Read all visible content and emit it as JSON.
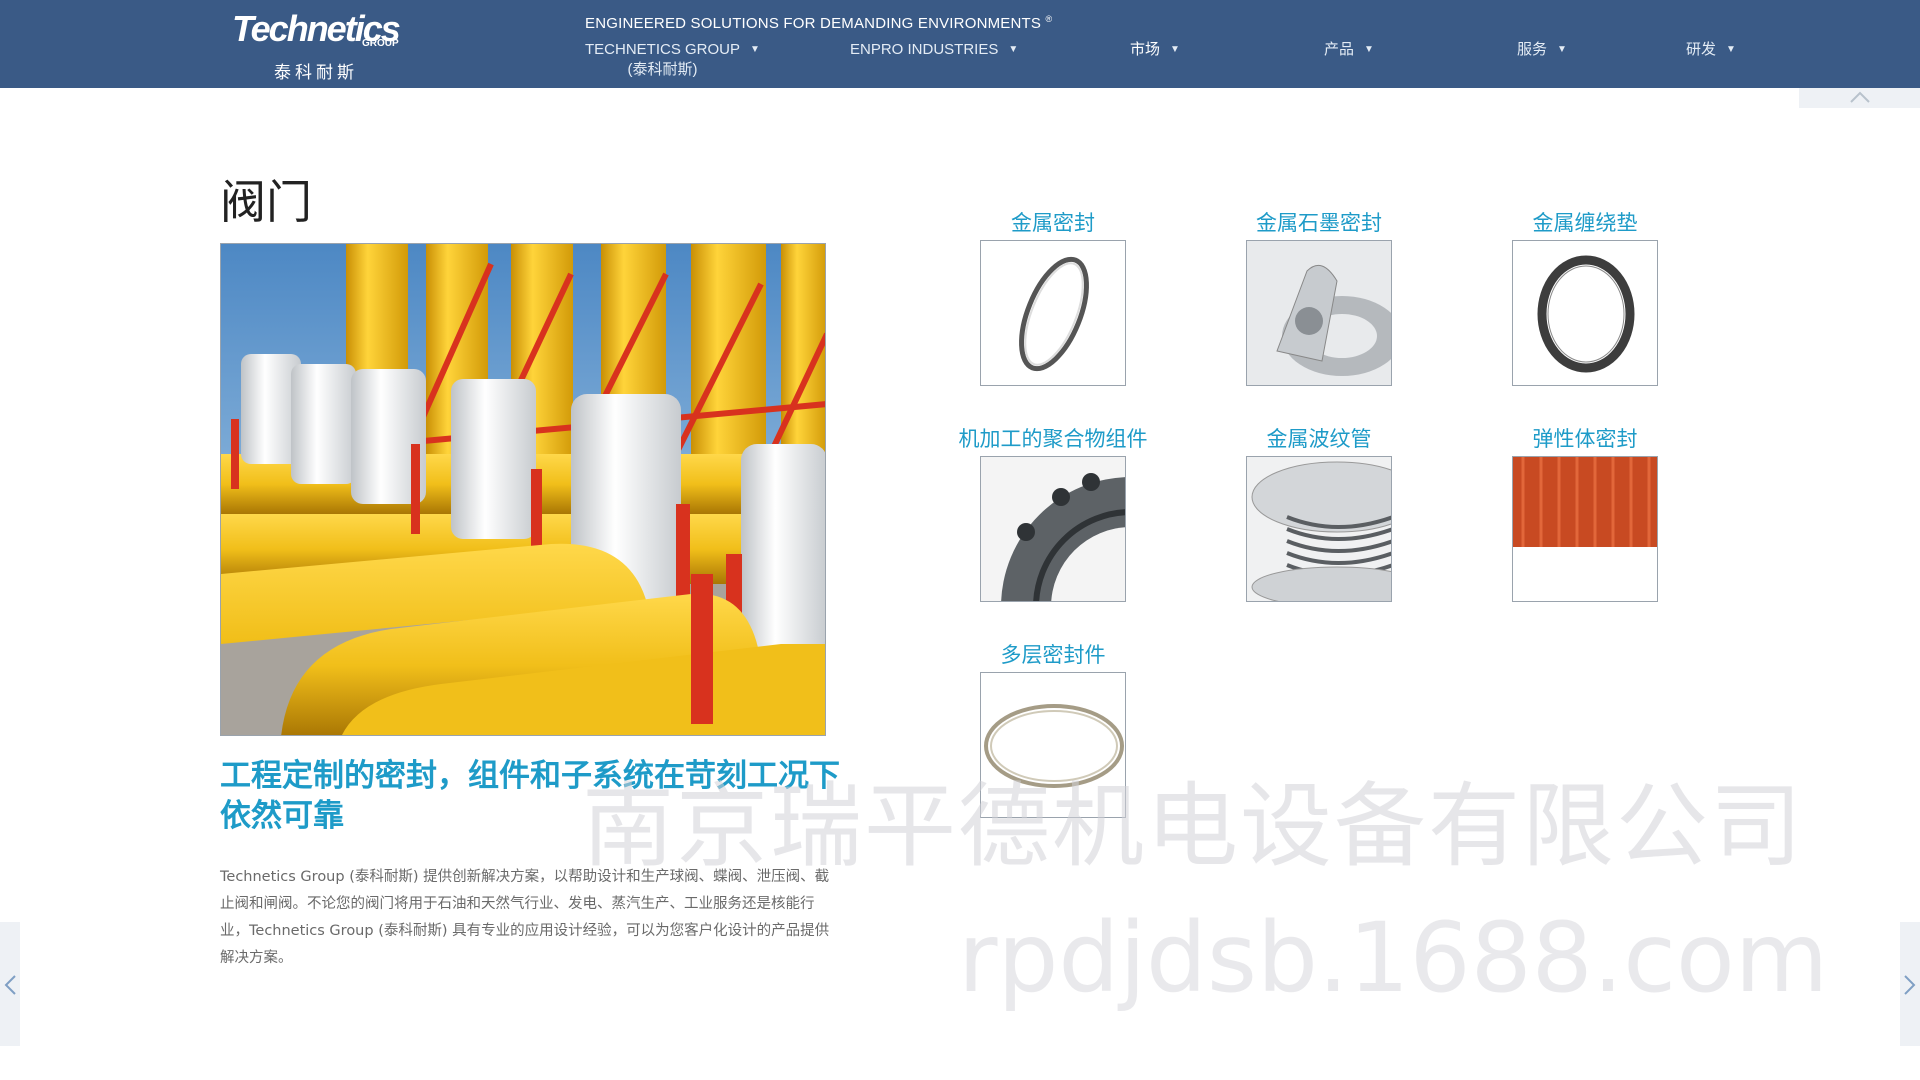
{
  "brand": {
    "logo_text": "Technetics",
    "logo_sub": "GROUP",
    "name_cn": "泰科耐斯"
  },
  "header": {
    "tagline": "ENGINEERED SOLUTIONS FOR DEMANDING ENVIRONMENTS",
    "tagline_mark": "®",
    "nav": [
      {
        "label": "TECHNETICS GROUP",
        "sub": "(泰科耐斯)"
      },
      {
        "label": "ENPRO INDUSTRIES"
      },
      {
        "label": "市场"
      },
      {
        "label": "产品"
      },
      {
        "label": "服务"
      },
      {
        "label": "研发"
      }
    ]
  },
  "main": {
    "title": "阀门",
    "headline": "工程定制的密封，组件和子系统在苛刻工况下依然可靠",
    "description": "Technetics Group (泰科耐斯) 提供创新解决方案，以帮助设计和生产球阀、蝶阀、泄压阀、截止阀和闸阀。不论您的阀门将用于石油和天然气行业、发电、蒸汽生产、工业服务还是核能行业，Technetics Group (泰科耐斯) 具有专业的应用设计经验，可以为您客户化设计的产品提供解决方案。"
  },
  "products": [
    {
      "name": "金属密封",
      "icon": "metal-seal-ring"
    },
    {
      "name": "金属石墨密封",
      "icon": "graphite-seal"
    },
    {
      "name": "金属缠绕垫",
      "icon": "spiral-wound-gasket"
    },
    {
      "name": "机加工的聚合物组件",
      "icon": "machined-polymer-part"
    },
    {
      "name": "金属波纹管",
      "icon": "metal-bellows"
    },
    {
      "name": "弹性体密封",
      "icon": "elastomer-seals"
    },
    {
      "name": "多层密封件",
      "icon": "multilayer-seal"
    }
  ],
  "watermark": {
    "line1": "南京瑞平德机电设备有限公司",
    "line2": "rpdjdsb.1688.com"
  },
  "colors": {
    "nav_bg": "#3a5a86",
    "accent": "#1e9bc8",
    "pipe_yellow": "#f1bf1a",
    "flange_red": "#d8321e"
  }
}
